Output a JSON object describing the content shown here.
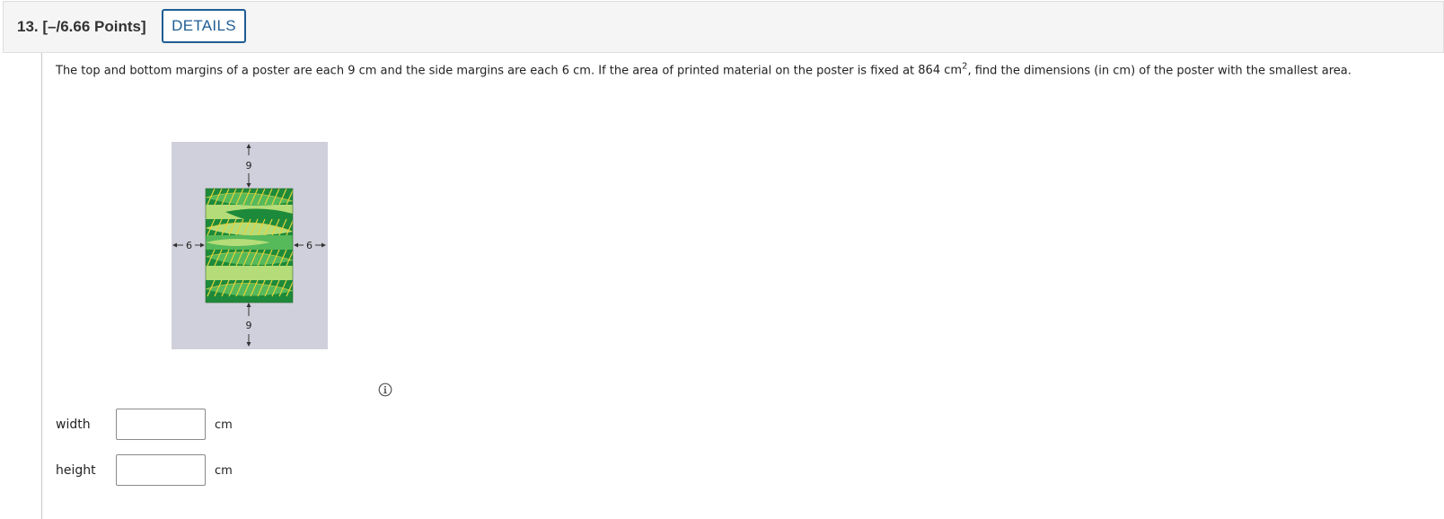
{
  "question": {
    "number": "13.",
    "points": "[–/6.66 Points]",
    "details_label": "DETAILS"
  },
  "problem": {
    "text_before": "The top and bottom margins of a poster are each 9 cm and the side margins are each 6 cm. If the area of printed material on the poster is fixed at ",
    "area_value": "864",
    "area_unit": "cm",
    "area_exponent": "2",
    "text_after": ", find the dimensions (in cm) of the poster with the smallest area."
  },
  "figure": {
    "top_margin_label": "9",
    "bottom_margin_label": "9",
    "left_margin_label": "6",
    "right_margin_label": "6",
    "poster_color": "#d0d0dc",
    "print_colors": [
      "#1c8a3a",
      "#56b95a",
      "#b4dc78",
      "#e6d23c"
    ]
  },
  "answers": {
    "width_label": "width",
    "width_value": "",
    "width_unit": "cm",
    "height_label": "height",
    "height_value": "",
    "height_unit": "cm"
  },
  "icons": {
    "info": "info-icon"
  }
}
